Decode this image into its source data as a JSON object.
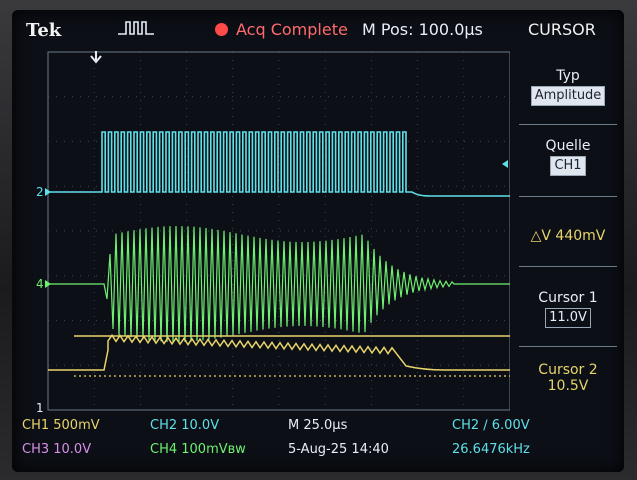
{
  "header": {
    "brand": "Tek",
    "trigger_icon": "pulse-trigger-icon",
    "acq_status": "Acq Complete",
    "mpos": "M Pos: 100.0µs",
    "menu_title": "CURSOR"
  },
  "sidebar": {
    "typ_label": "Typ",
    "typ_value": "Amplitude",
    "quelle_label": "Quelle",
    "quelle_value": "CH1",
    "delta_v": "△V 440mV",
    "cursor1_label": "Cursor 1",
    "cursor1_value": "11.0V",
    "cursor2_label": "Cursor 2",
    "cursor2_value": "10.5V"
  },
  "markers": {
    "ch2": "2",
    "ch4": "4",
    "ch1": "1"
  },
  "status": {
    "ch1": "CH1  500mV",
    "ch2": "CH2  10.0V",
    "ch3": "CH3  10.0V",
    "ch4": "CH4  100mVʙw",
    "timebase": "M 25.0µs",
    "date": "5-Aug-25 14:40",
    "trigger": "CH2 ∕ 6.00V",
    "freq": "26.6476kHz"
  },
  "colors": {
    "ch1": "#e8d46a",
    "ch2": "#5fe0e8",
    "ch4": "#6ff06f",
    "grid": "#4b5566"
  }
}
